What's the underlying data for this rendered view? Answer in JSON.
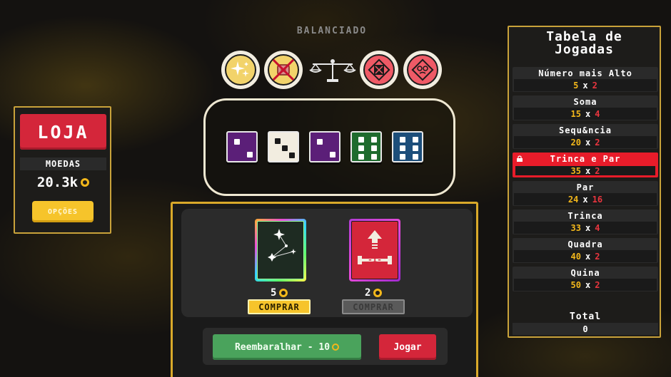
{
  "shop": {
    "title": "LOJA",
    "coins_label": "MOEDAS",
    "coins_value": "20.3k",
    "options_label": "OPÇÕES"
  },
  "header": {
    "difficulty": "BALANCIADO"
  },
  "modifiers": [
    {
      "name": "sparkle-token",
      "color": "#f2d36a"
    },
    {
      "name": "forbidden-pig-token",
      "color": "#f2d36a"
    },
    {
      "name": "dark-dice-token",
      "color": "#ef5a66"
    },
    {
      "name": "cards-token",
      "color": "#ef5a66"
    }
  ],
  "dice": [
    {
      "value": 2,
      "color": "#5b1f78",
      "pip": "#ffffff"
    },
    {
      "value": 3,
      "color": "#f2ede0",
      "pip": "#1a1a1a"
    },
    {
      "value": 2,
      "color": "#5b1f78",
      "pip": "#ffffff"
    },
    {
      "value": 6,
      "color": "#1e6b2e",
      "pip": "#ffffff"
    },
    {
      "value": 6,
      "color": "#1d4e7a",
      "pip": "#ffffff"
    }
  ],
  "shop_cards": [
    {
      "name": "constellation-card",
      "price": "5",
      "buy_label": "COMPRAR",
      "enabled": true
    },
    {
      "name": "minus-one-card",
      "price": "2",
      "buy_label": "COMPRAR",
      "enabled": false
    }
  ],
  "minus_card_text": "-1-",
  "actions": {
    "shuffle_label": "Reembaralhar - 10",
    "play_label": "Jogar"
  },
  "plays": {
    "title_line1": "Tabela de",
    "title_line2": "Jogadas",
    "rows": [
      {
        "name": "Número mais Alto",
        "chips": "5",
        "mult": "2",
        "locked": false
      },
      {
        "name": "Soma",
        "chips": "15",
        "mult": "4",
        "locked": false
      },
      {
        "name": "Sequ&ncia",
        "chips": "20",
        "mult": "2",
        "locked": false
      },
      {
        "name": "Trinca e Par",
        "chips": "35",
        "mult": "2",
        "locked": true
      },
      {
        "name": "Par",
        "chips": "24",
        "mult": "16",
        "locked": false
      },
      {
        "name": "Trinca",
        "chips": "33",
        "mult": "4",
        "locked": false
      },
      {
        "name": "Quadra",
        "chips": "40",
        "mult": "2",
        "locked": false
      },
      {
        "name": "Quina",
        "chips": "50",
        "mult": "2",
        "locked": false
      }
    ],
    "times_sign": "x",
    "total_label": "Total",
    "total_value": "0"
  },
  "colors": {
    "accent_gold": "#c9a23a",
    "red": "#d4263a",
    "green": "#4aa35c",
    "yellow": "#f6c42b",
    "chips": "#f2b71b",
    "mult": "#e8353e"
  }
}
